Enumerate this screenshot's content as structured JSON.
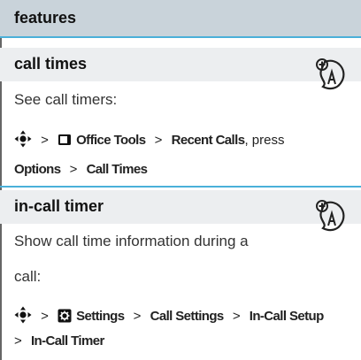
{
  "header": {
    "title": "features"
  },
  "sections": [
    {
      "title": "call times",
      "body_lines": [
        "See call timers:"
      ],
      "path_line1": [
        "Office Tools",
        "Recent Calls"
      ],
      "path_suffix": "press",
      "path_line2": [
        "Options",
        "Call Times"
      ],
      "icon": "network-feature-icon"
    },
    {
      "title": "in-call timer",
      "body_lines": [
        "Show call time information during a",
        "call:"
      ],
      "path_line1": [
        "Settings",
        "Call Settings",
        "In-Call Setup"
      ],
      "path_line2": [
        "In-Call Timer"
      ],
      "icon": "network-feature-icon"
    }
  ],
  "separator": ">",
  "colors": {
    "accent_rule": "#4ab0d9",
    "header_bg": "#c9d3da",
    "section_bg": "#eceef0"
  }
}
